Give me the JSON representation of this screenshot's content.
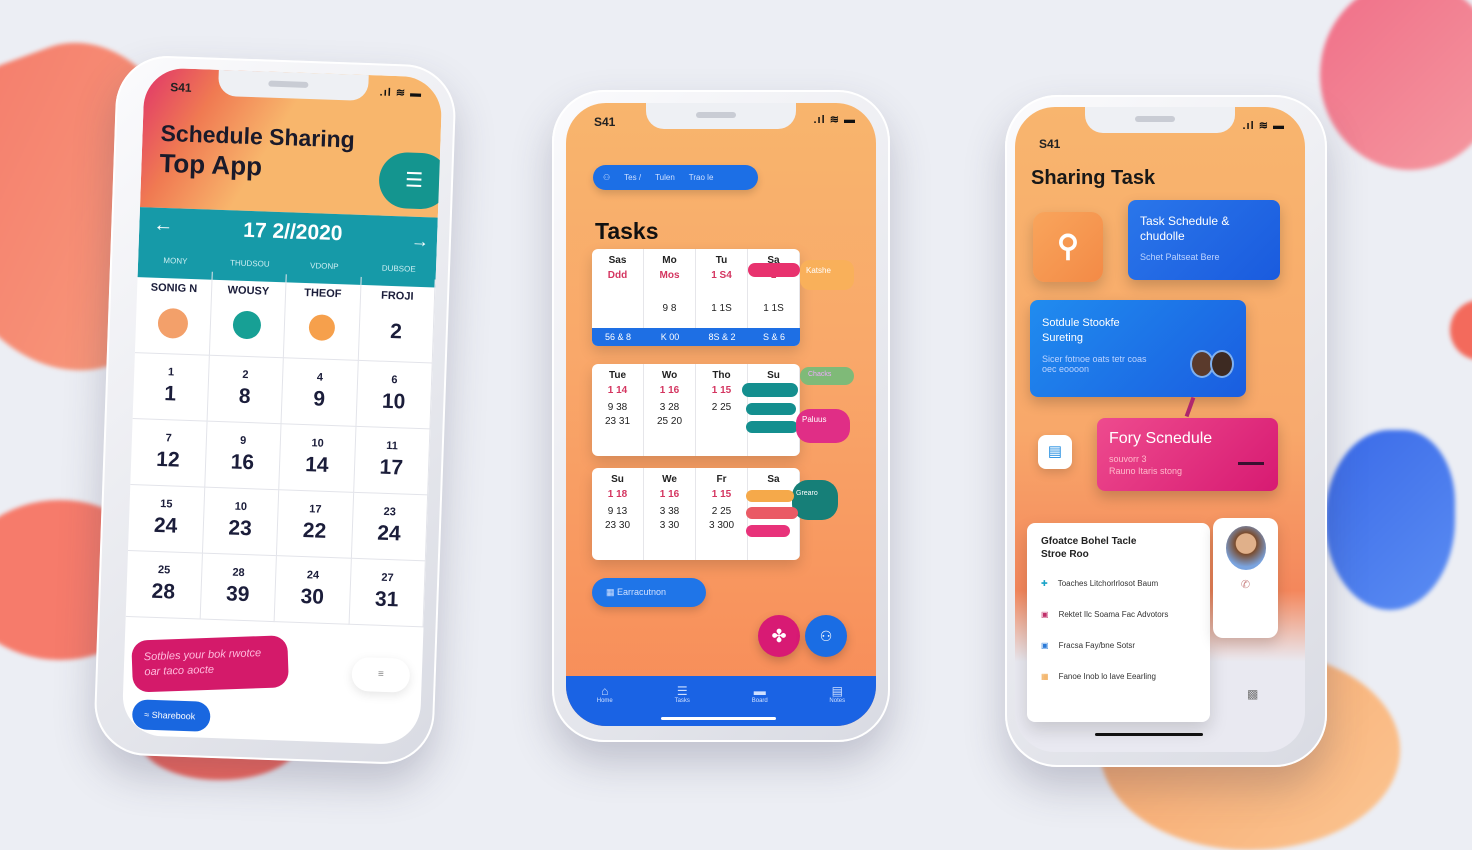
{
  "phone1": {
    "status_time": "S41",
    "title_line1": "Schedule Sharing",
    "title_line2": "Top App",
    "date": "17 2//2020",
    "subdays": [
      "MONY",
      "THUDSOU",
      "VDONP",
      "DUBSOE"
    ],
    "days": [
      "SONIG N",
      "WOUSY",
      "THEOF",
      "FROJI"
    ],
    "first_row_value": "2",
    "rows": [
      [
        [
          "1",
          "1"
        ],
        [
          "2",
          "8"
        ],
        [
          "4",
          "9"
        ],
        [
          "6",
          "10"
        ]
      ],
      [
        [
          "7",
          "12"
        ],
        [
          "9",
          "16"
        ],
        [
          "10",
          "14"
        ],
        [
          "11",
          "17"
        ]
      ],
      [
        [
          "15",
          "24"
        ],
        [
          "10",
          "23"
        ],
        [
          "17",
          "22"
        ],
        [
          "23",
          "24"
        ]
      ],
      [
        [
          "25",
          "28"
        ],
        [
          "28",
          "39"
        ],
        [
          "24",
          "30"
        ],
        [
          "27",
          "31"
        ]
      ]
    ],
    "promo_text": "Sotbles your bok rwotce oar taco aocte",
    "share_button": "Sharebook",
    "colors": {
      "teal": "#169aa8",
      "orange": "#f8b66c",
      "pink": "#d41a6a",
      "blue": "#1967e0"
    }
  },
  "phone2": {
    "status_time": "S41",
    "breadcrumb": [
      "Tes /",
      "Tulen",
      "Trao le"
    ],
    "title": "Tasks",
    "cards": [
      {
        "days": [
          "Sas",
          "Mo",
          "Tu",
          "Sa"
        ],
        "red": [
          "Ddd",
          "Mos",
          "1 S4",
          "1"
        ],
        "nums": [
          "",
          "9 8",
          "1 1S",
          "1 1S"
        ],
        "footer": [
          "56 & 8",
          "K 00",
          "8S & 2",
          "S & 6"
        ]
      },
      {
        "days": [
          "Tue",
          "Wo",
          "Tho",
          "Su"
        ],
        "red": [
          "1 14",
          "1 16",
          "1 15",
          ""
        ],
        "nums": [
          "9 38",
          "3 28",
          "2 25",
          ""
        ],
        "nums2": [
          "23 31",
          "25 20",
          "",
          ""
        ]
      },
      {
        "days": [
          "Su",
          "We",
          "Fr",
          "Sa"
        ],
        "red": [
          "1 18",
          "1 16",
          "1 15",
          ""
        ],
        "nums": [
          "9 13",
          "3 38",
          "2 25",
          ""
        ],
        "nums2": [
          "23 30",
          "3 30",
          "3 300",
          ""
        ]
      }
    ],
    "side_labels": [
      "Katshe",
      "Chacks",
      "Paluus",
      "Grearo"
    ],
    "action_button": "Earracutnon",
    "nav": [
      "Home",
      "Tasks",
      "Board",
      "Notes"
    ]
  },
  "phone3": {
    "status_time": "S41",
    "title": "Sharing Task",
    "card1_title": "Task Schedule & chudolle",
    "card1_sub": "Schet Paltseat Bere",
    "card2_title": "Sotdule Stookfe Sureting",
    "card2_sub": "Sicer fotnoe oats tetr coas oec eoooon",
    "card3_title": "Fory Scnedule",
    "card3_sub": "souvorr 3",
    "card3_sub2": "Rauno Itaris stong",
    "list_title": "Gfoatce Bohel Tacle Stroe Roo",
    "list_items": [
      "Toaches Litchorlrlosot Baum",
      "Rektet Ilc Soama Fac Advotors",
      "Fracsa Fay/bne Sotsr",
      "Fanoe Inob lo lave Eearling"
    ]
  }
}
